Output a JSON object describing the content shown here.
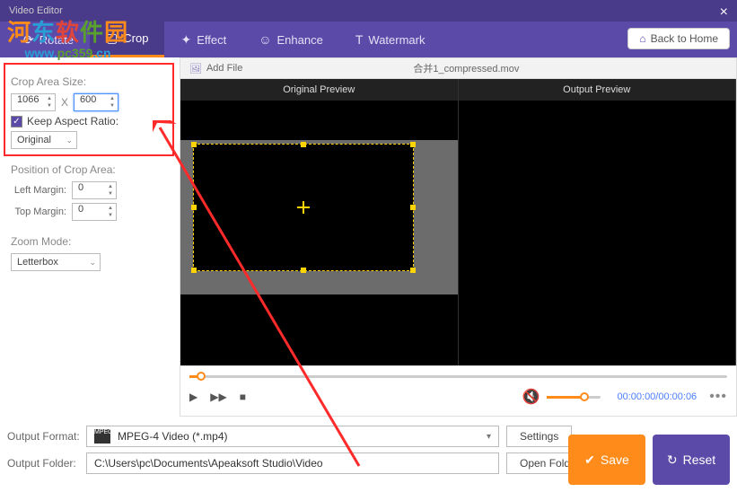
{
  "title": "Video Editor",
  "toolbar": {
    "rotate": "Rotate",
    "crop": "Crop",
    "effect": "Effect",
    "enhance": "Enhance",
    "watermark": "Watermark",
    "back_home": "Back to Home"
  },
  "sidebar": {
    "crop_area_size": "Crop Area Size:",
    "width": "1066",
    "height": "600",
    "x": "X",
    "keep_aspect": "Keep Aspect Ratio:",
    "aspect_value": "Original",
    "pos_title": "Position of Crop Area:",
    "left_margin_label": "Left Margin:",
    "left_margin": "0",
    "top_margin_label": "Top Margin:",
    "top_margin": "0",
    "zoom_title": "Zoom Mode:",
    "zoom_value": "Letterbox"
  },
  "filebar": {
    "add_file": "Add File",
    "filename": "合并1_compressed.mov"
  },
  "preview": {
    "original": "Original Preview",
    "output": "Output Preview"
  },
  "playbar": {
    "time": "00:00:00/00:00:06"
  },
  "bottom": {
    "format_label": "Output Format:",
    "format_value": "MPEG-4 Video (*.mp4)",
    "settings": "Settings",
    "folder_label": "Output Folder:",
    "folder_value": "C:\\Users\\pc\\Documents\\Apeaksoft Studio\\Video",
    "open_folder": "Open Folder",
    "save": "Save",
    "reset": "Reset"
  },
  "watermark": {
    "cn1": "河",
    "cn2": "东",
    "cn3": "软",
    "cn4": "件",
    "cn5": "园",
    "url_pre": "www.",
    "url_dom": "pc359",
    "url_suf": ".cn"
  }
}
